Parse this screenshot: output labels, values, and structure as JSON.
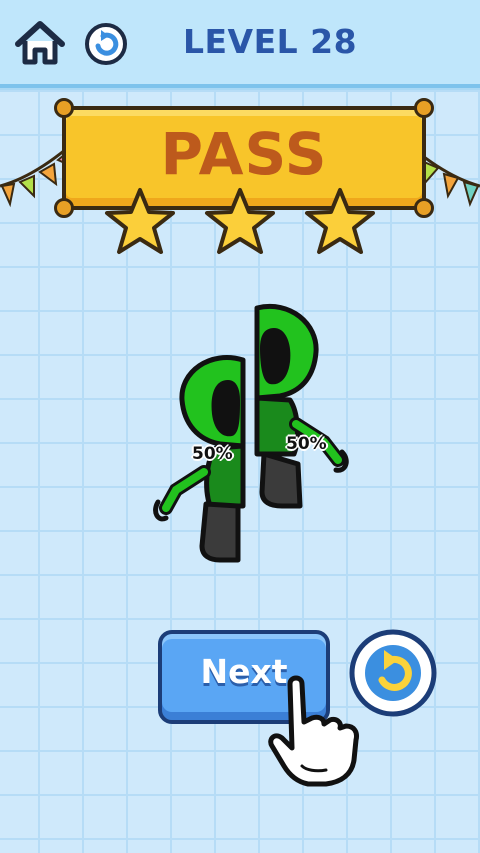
{
  "header": {
    "home_icon": "home-icon",
    "reload_icon": "reload-icon",
    "level_label": "LEVEL 28"
  },
  "result": {
    "title": "PASS",
    "stars_earned": 3,
    "stars_total": 3
  },
  "robot": {
    "left_half_percent": "50%",
    "right_half_percent": "50%"
  },
  "actions": {
    "next_label": "Next",
    "retry_icon": "retry-icon"
  },
  "colors": {
    "accent_blue": "#2a56a8",
    "banner_yellow": "#f8c52a",
    "pass_text": "#bd5a1c",
    "robot_green": "#22c21e",
    "button_blue": "#5aa6f4"
  }
}
